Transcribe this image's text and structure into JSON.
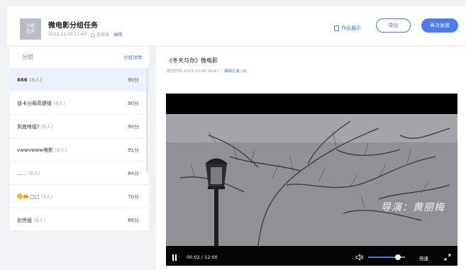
{
  "header": {
    "thumb_text": "分组\n任务",
    "title": "微电影分组任务",
    "datetime": "2023-11-15 11:40",
    "status": "已结束",
    "edit_label": "编辑",
    "works_label": "作品展示",
    "export_label": "导出",
    "resend_label": "再次发放",
    "accent_color": "#4a7bf0"
  },
  "groups_panel": {
    "title": "分组",
    "detail_link": "分组详情",
    "items": [
      {
        "name": "666",
        "count": "(8人)",
        "score": "90分",
        "active": true
      },
      {
        "name": "迪卡分局高健组",
        "count": "(8人)",
        "score": "90分"
      },
      {
        "name": "到底啥组?",
        "count": "(8人)",
        "score": "90分"
      },
      {
        "name": "vwwvwww电影",
        "count": "(8人)",
        "score": "91分"
      },
      {
        "name": "......",
        "count": "(8人)",
        "score": "84分"
      },
      {
        "name": "□□",
        "count": "(3人)",
        "score": "70分",
        "emoji": true
      },
      {
        "name": "创世组",
        "count": "(8人)",
        "score": "86分"
      }
    ]
  },
  "submission": {
    "title": "《冬天与你》微电影",
    "submit_time": "提交时间 2023-12-08 09:47",
    "edit_record": "编辑记录 (3)",
    "caption": "导演：黄丽梅"
  },
  "player": {
    "current_time": "00:02",
    "duration": "12:00",
    "time_text": "00:02 / 12:00",
    "volume": 0.8,
    "speed_label": "倍速"
  }
}
